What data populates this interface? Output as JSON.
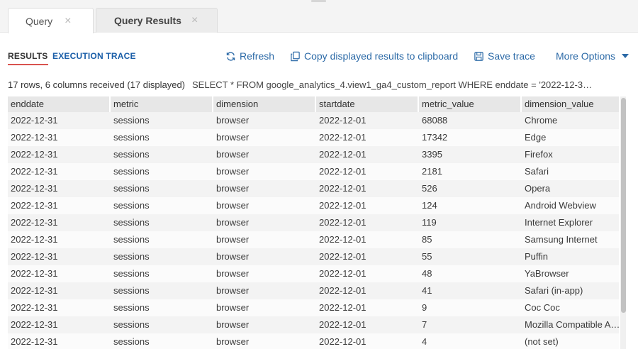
{
  "tabs": [
    {
      "label": "Query",
      "active": false
    },
    {
      "label": "Query Results",
      "active": true
    }
  ],
  "tab_close_glyph": "×",
  "subtabs": {
    "results": "RESULTS",
    "trace": "EXECUTION TRACE"
  },
  "actions": {
    "refresh": "Refresh",
    "copy": "Copy displayed results to clipboard",
    "save": "Save trace",
    "more": "More Options"
  },
  "icons": [
    "refresh-icon",
    "copy-icon",
    "save-icon",
    "caret-down-icon",
    "close-icon"
  ],
  "colors": {
    "accent_link": "#2c6aa7",
    "active_underline": "#d9534f"
  },
  "summary": {
    "count": "17 rows, 6 columns received (17 displayed)",
    "sql": "SELECT * FROM google_analytics_4.view1_ga4_custom_report WHERE enddate = '2022-12-3…"
  },
  "table": {
    "columns": [
      "enddate",
      "metric",
      "dimension",
      "startdate",
      "metric_value",
      "dimension_value"
    ],
    "rows": [
      [
        "2022-12-31",
        "sessions",
        "browser",
        "2022-12-01",
        "68088",
        "Chrome"
      ],
      [
        "2022-12-31",
        "sessions",
        "browser",
        "2022-12-01",
        "17342",
        "Edge"
      ],
      [
        "2022-12-31",
        "sessions",
        "browser",
        "2022-12-01",
        "3395",
        "Firefox"
      ],
      [
        "2022-12-31",
        "sessions",
        "browser",
        "2022-12-01",
        "2181",
        "Safari"
      ],
      [
        "2022-12-31",
        "sessions",
        "browser",
        "2022-12-01",
        "526",
        "Opera"
      ],
      [
        "2022-12-31",
        "sessions",
        "browser",
        "2022-12-01",
        "124",
        "Android Webview"
      ],
      [
        "2022-12-31",
        "sessions",
        "browser",
        "2022-12-01",
        "119",
        "Internet Explorer"
      ],
      [
        "2022-12-31",
        "sessions",
        "browser",
        "2022-12-01",
        "85",
        "Samsung Internet"
      ],
      [
        "2022-12-31",
        "sessions",
        "browser",
        "2022-12-01",
        "55",
        "Puffin"
      ],
      [
        "2022-12-31",
        "sessions",
        "browser",
        "2022-12-01",
        "48",
        "YaBrowser"
      ],
      [
        "2022-12-31",
        "sessions",
        "browser",
        "2022-12-01",
        "41",
        "Safari (in-app)"
      ],
      [
        "2022-12-31",
        "sessions",
        "browser",
        "2022-12-01",
        "9",
        "Coc Coc"
      ],
      [
        "2022-12-31",
        "sessions",
        "browser",
        "2022-12-01",
        "7",
        "Mozilla Compatible Agent"
      ],
      [
        "2022-12-31",
        "sessions",
        "browser",
        "2022-12-01",
        "4",
        "(not set)"
      ]
    ]
  }
}
